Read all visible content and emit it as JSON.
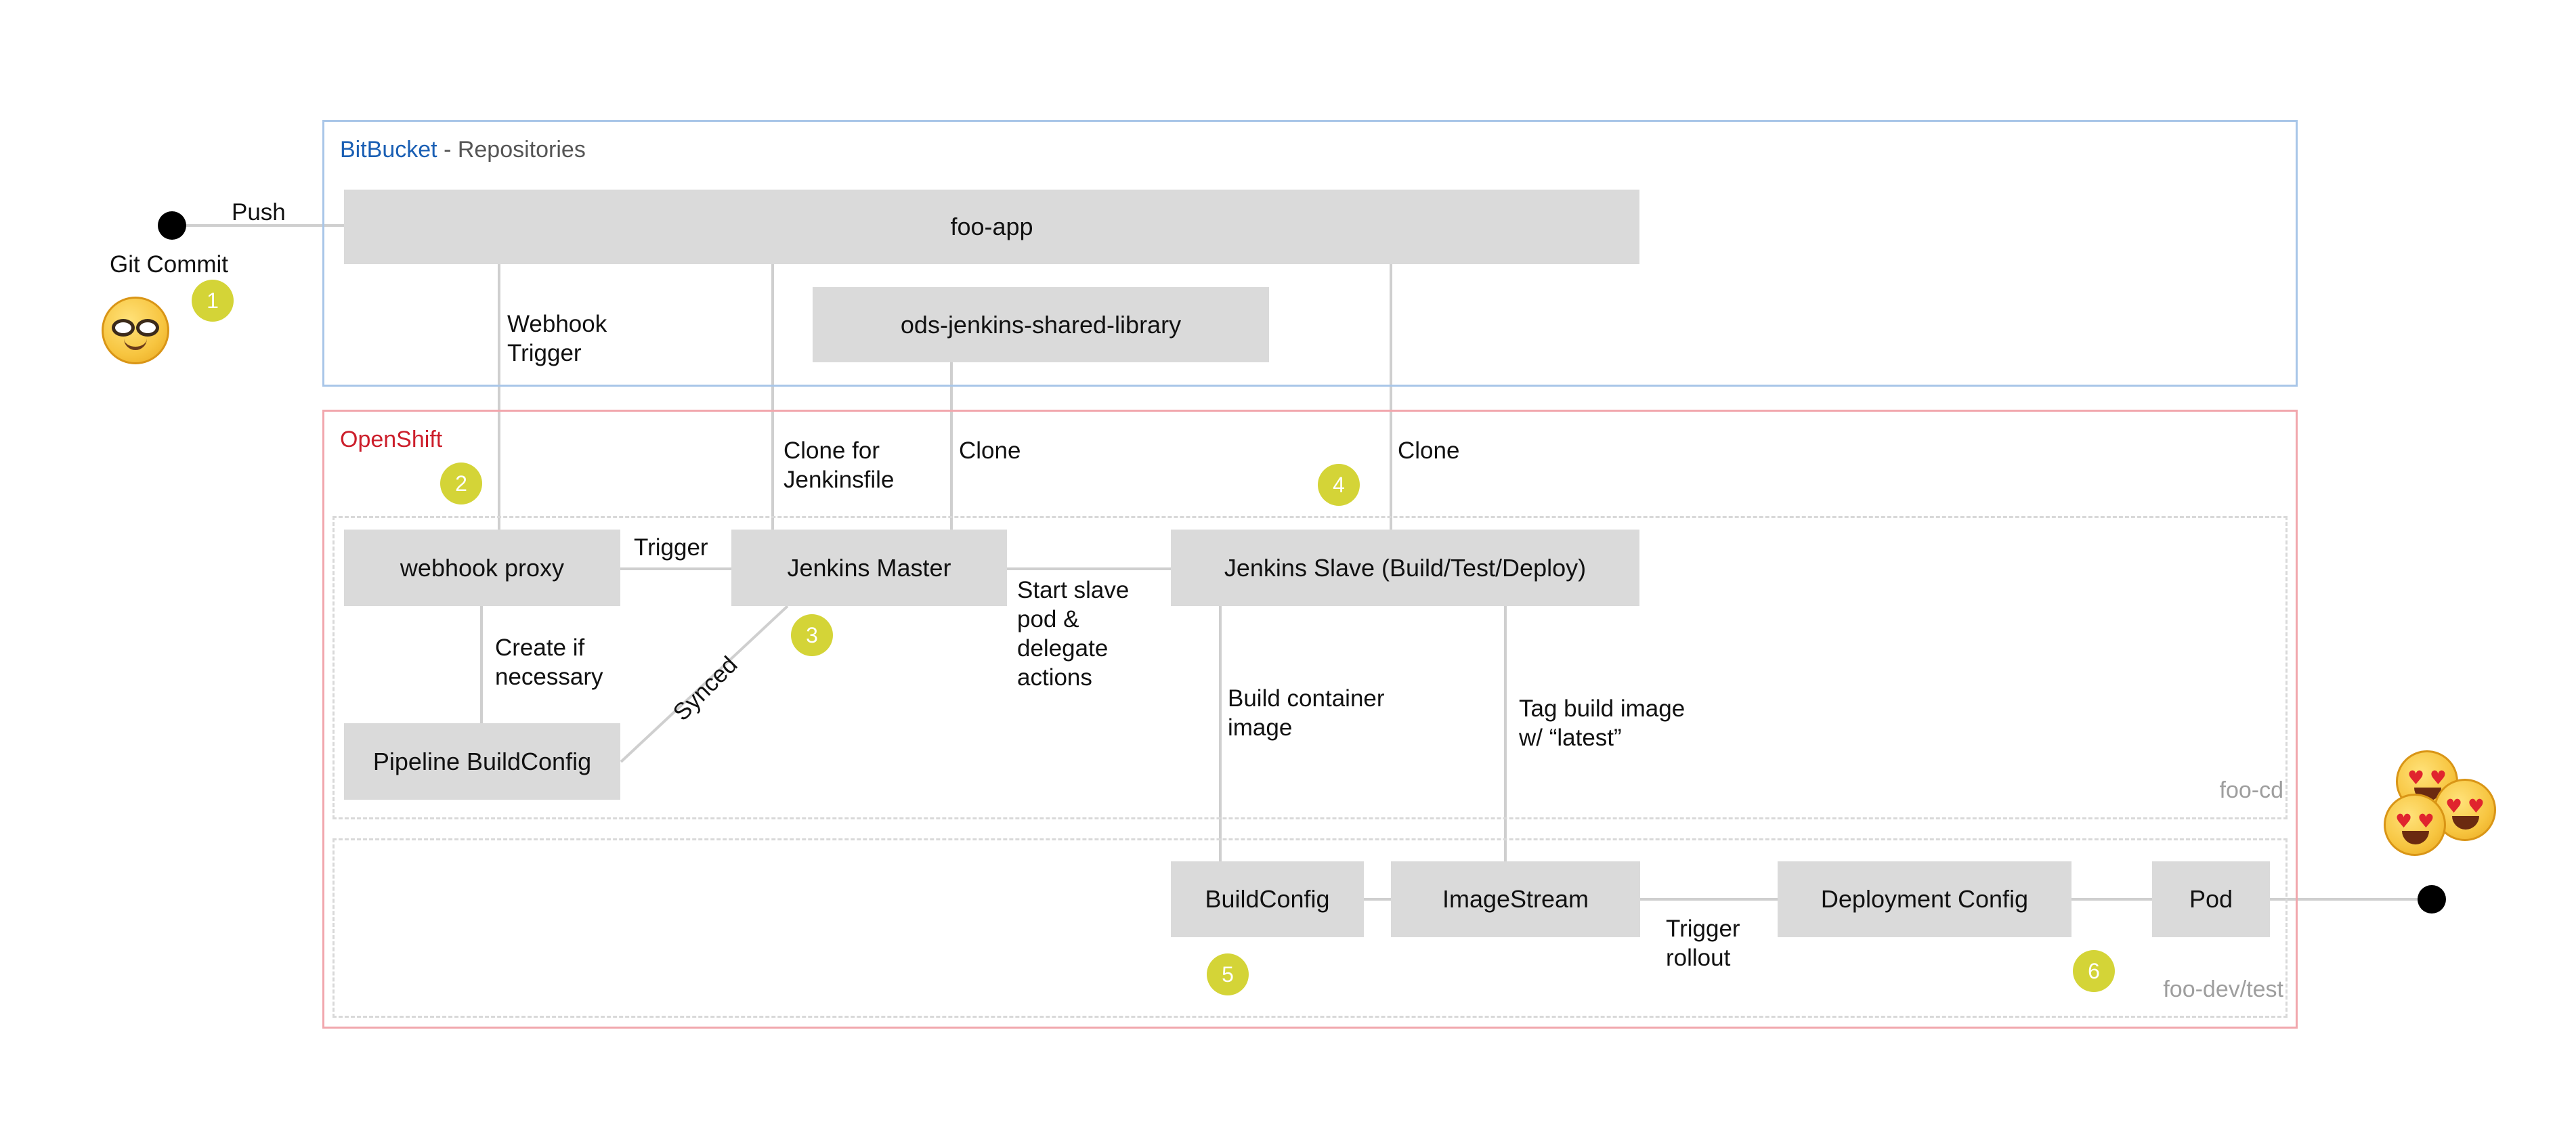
{
  "regions": {
    "bitbucket": {
      "brand": "BitBucket",
      "suffix": " - Repositories"
    },
    "openshift": {
      "title": "OpenShift"
    },
    "namespaces": {
      "cd": "foo-cd",
      "dev": "foo-dev/test"
    }
  },
  "nodes": {
    "foo_app": "foo-app",
    "shared_library": "ods-jenkins-shared-library",
    "webhook_proxy": "webhook proxy",
    "jenkins_master": "Jenkins Master",
    "jenkins_slave": "Jenkins Slave (Build/Test/Deploy)",
    "pipeline_buildconfig": "Pipeline BuildConfig",
    "buildconfig": "BuildConfig",
    "imagestream": "ImageStream",
    "deployment_config": "Deployment Config",
    "pod": "Pod"
  },
  "labels": {
    "push": "Push",
    "git_commit": "Git Commit",
    "webhook_trigger": "Webhook\nTrigger",
    "clone_for_jenkinsfile": "Clone for\nJenkinsfile",
    "clone_library": "Clone",
    "clone_slave": "Clone",
    "trigger": "Trigger",
    "create_if_necessary": "Create if\nnecessary",
    "synced": "Synced",
    "start_slave": "Start slave\npod &\ndelegate\nactions",
    "build_container_image": "Build container\nimage",
    "tag_build_image": "Tag build image\nw/ “latest”",
    "trigger_rollout": "Trigger\nrollout"
  },
  "steps": [
    "1",
    "2",
    "3",
    "4",
    "5",
    "6"
  ],
  "icons": {
    "start": "nerd-face-icon",
    "end": "heart-eyes-icon",
    "start_dot": "commit-dot-icon",
    "end_dot": "end-dot-icon"
  },
  "colors": {
    "bitbucket_border": "#a9c6e8",
    "openshift_border": "#f1a7ad",
    "node_fill": "#dadada",
    "step_badge": "#d4d437",
    "bitbucket_text": "#1a5fb4",
    "openshift_text": "#cc1e2b"
  }
}
